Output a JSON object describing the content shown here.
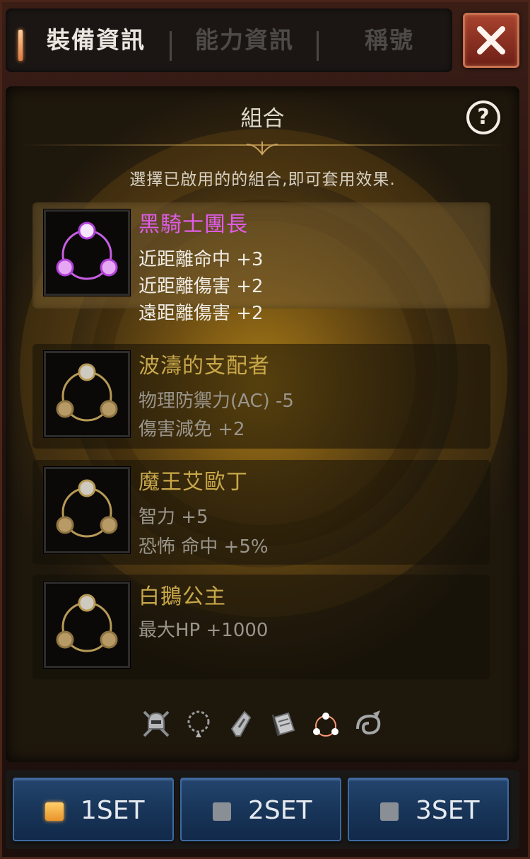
{
  "tabs": {
    "equipment": "裝備資訊",
    "ability": "能力資訊",
    "title": "稱號"
  },
  "panel": {
    "title": "組合",
    "subtitle": "選擇已啟用的的組合,即可套用效果.",
    "help": "?"
  },
  "sets": [
    {
      "name": "黑騎士團長",
      "effects": [
        "近距離命中 +3",
        "近距離傷害 +2",
        "遠距離傷害 +2"
      ],
      "active": true
    },
    {
      "name": "波濤的支配者",
      "effects": [
        "物理防禦力(AC) -5",
        "傷害減免 +2"
      ],
      "active": false
    },
    {
      "name": "魔王艾歐丁",
      "effects": [
        "智力 +5",
        "恐怖 命中 +5%"
      ],
      "active": false
    },
    {
      "name": "白鵝公主",
      "effects": [
        "最大HP +1000"
      ],
      "active": false
    }
  ],
  "bottom_icons": [
    "helmet-skull-icon",
    "necklace-icon",
    "amulet-icon",
    "scroll-icon",
    "set-combo-icon",
    "dragon-icon"
  ],
  "set_buttons": [
    {
      "label": "1SET",
      "selected": true
    },
    {
      "label": "2SET",
      "selected": false
    },
    {
      "label": "3SET",
      "selected": false
    }
  ],
  "colors": {
    "active_name": "#e05ce8",
    "inactive_name": "#c9a84a",
    "button_blue": "#173457",
    "close_red": "#a8432e"
  }
}
